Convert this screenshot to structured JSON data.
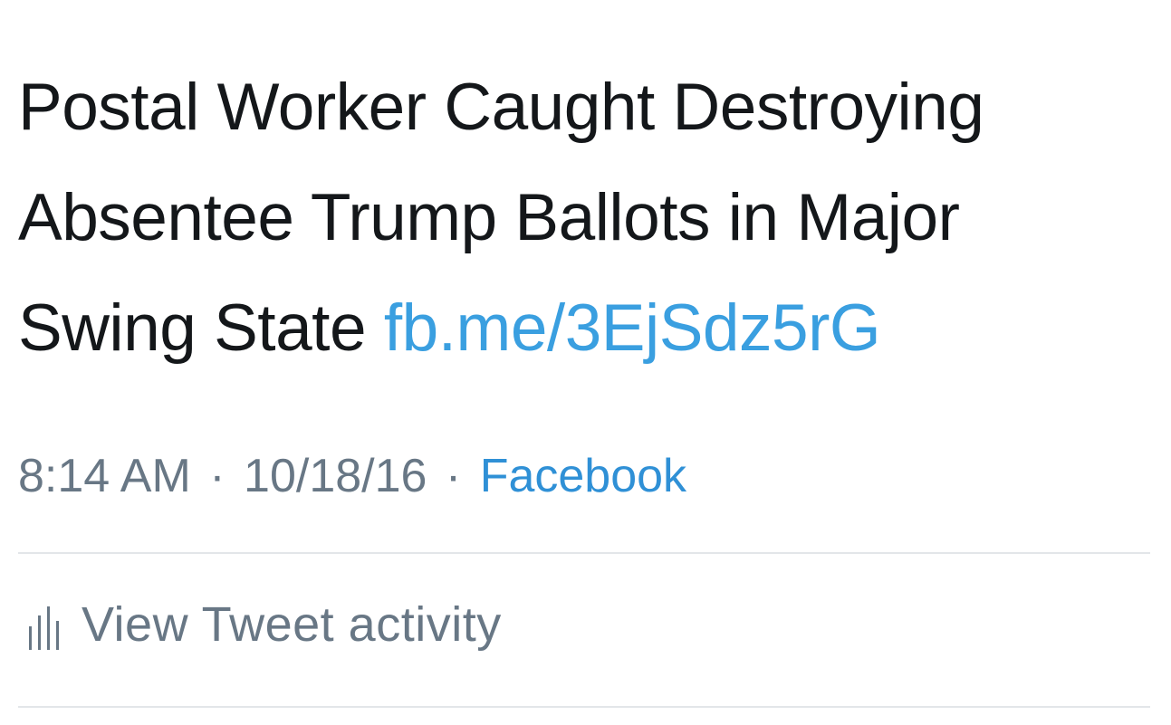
{
  "tweet": {
    "text_lines": [
      "Postal Worker Caught Destroying",
      "Absentee Trump Ballots in Major",
      "Swing State "
    ],
    "link": "fb.me/3EjSdz5rG",
    "time": "8:14 AM",
    "separator": "·",
    "date": "10/18/16",
    "source": "Facebook"
  },
  "actions": {
    "view_activity_label": "View Tweet activity",
    "activity_icon": "bar-chart-icon"
  },
  "colors": {
    "text": "#14171a",
    "link": "#3a9fe0",
    "meta": "#687785",
    "divider": "#e3e6e9"
  }
}
